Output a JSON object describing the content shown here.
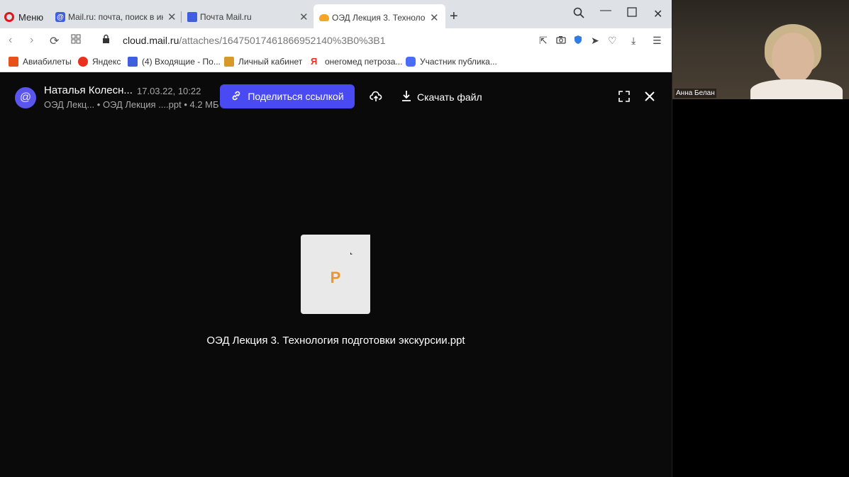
{
  "browser": {
    "menu_label": "Меню",
    "tabs": [
      {
        "title": "Mail.ru: почта, поиск в инт",
        "icon": "mailru-at-icon"
      },
      {
        "title": "Почта Mail.ru",
        "icon": "mail-envelope-icon"
      },
      {
        "title": "ОЭД Лекция 3. Технология",
        "icon": "cloud-icon",
        "active": true
      }
    ],
    "new_tab": "+",
    "url_domain": "cloud.mail.ru",
    "url_path": "/attaches/16475017461866952140%3B0%3B1",
    "bookmarks": [
      {
        "label": "Авиабилеты",
        "color": "#e8501c"
      },
      {
        "label": "Яндекс",
        "color": "#e8301c"
      },
      {
        "label": "(4) Входящие - По...",
        "color": "#3f5fe0"
      },
      {
        "label": "Личный кабинет",
        "color": "#d69a2a"
      },
      {
        "label": "онегомед петроза...",
        "color": "#e8301c"
      },
      {
        "label": "Участник публика...",
        "color": "#4a6cf7"
      }
    ]
  },
  "viewer": {
    "avatar_glyph": "@",
    "sender": "Наталья Колесн...",
    "date": "17.03.22, 10:22",
    "path": "ОЭД Лекц... • ОЭД Лекция ....ppt • 4.2 МБ",
    "share_label": "Поделиться ссылкой",
    "download_label": "Скачать файл",
    "file_letter": "P",
    "file_name": "ОЭД Лекция 3. Технология подготовки экскурсии.ppt",
    "accent": "#4a4af2"
  },
  "video": {
    "participant_name": "Анна Белан"
  }
}
